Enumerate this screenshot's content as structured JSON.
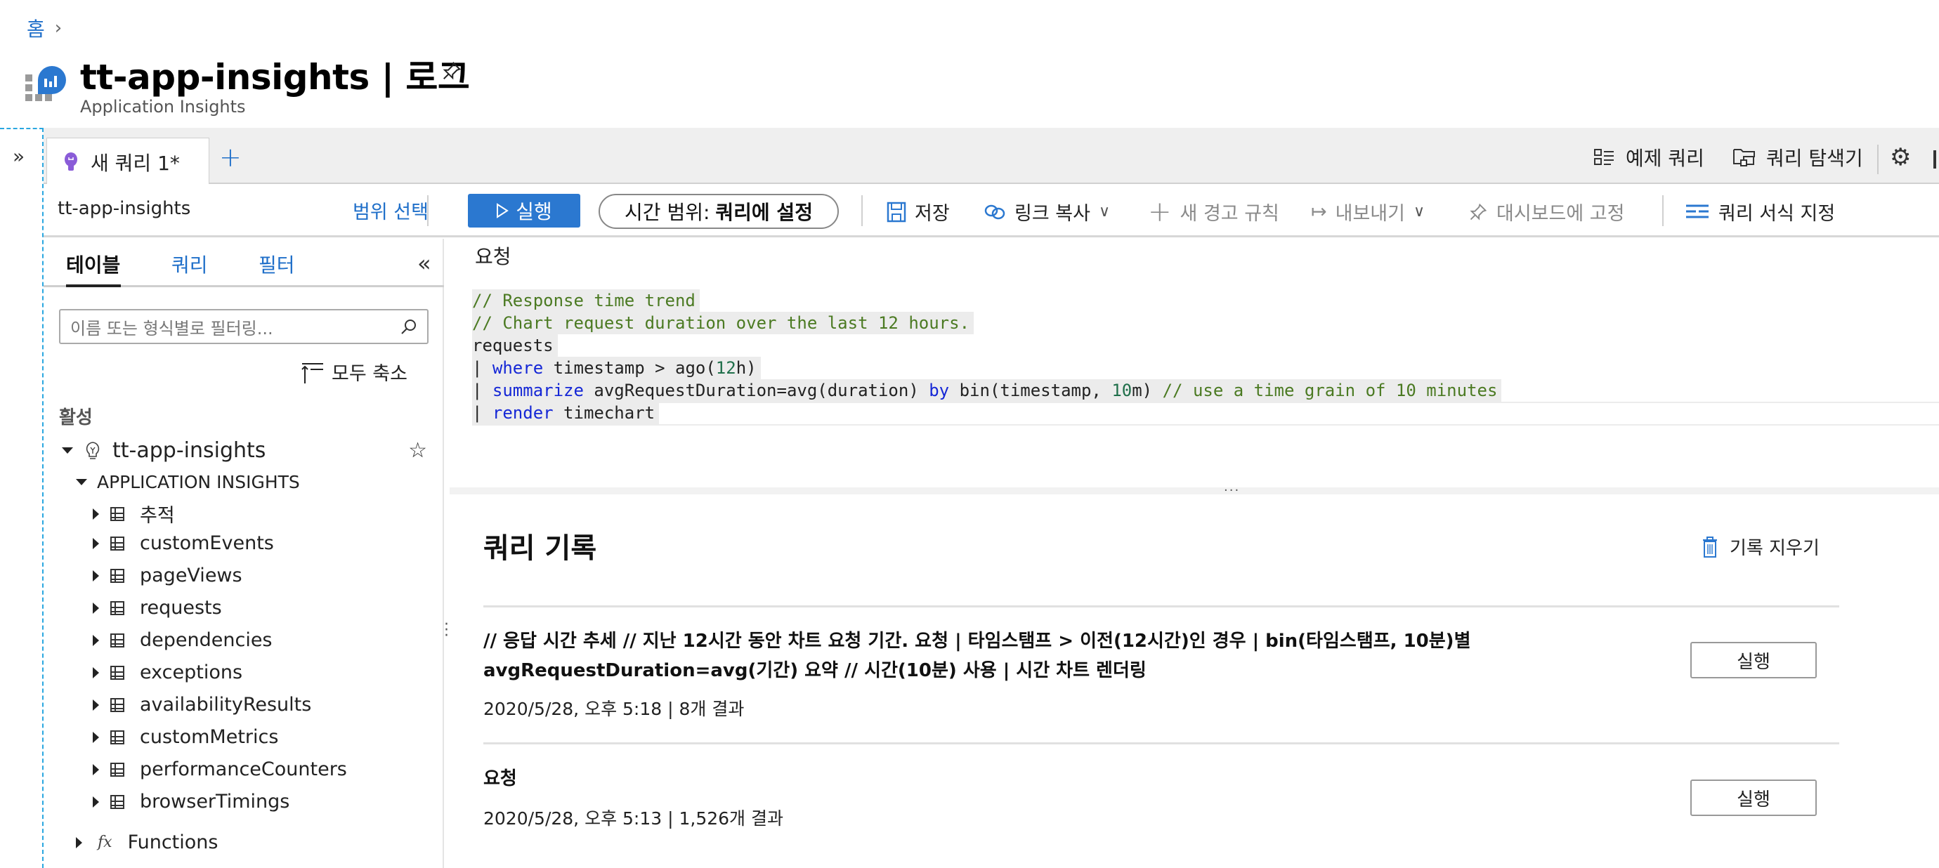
{
  "header": {
    "breadcrumb": [
      "홈"
    ],
    "title": "tt-app-insights | 로그",
    "subtitle": "Application Insights"
  },
  "tabs": {
    "items": [
      {
        "label": "새 쿼리 1*",
        "active": true,
        "icon": "lightbulb-icon"
      }
    ],
    "add_label": "+",
    "right": [
      {
        "label": "예제 쿼리",
        "icon": "sample-queries-icon"
      },
      {
        "label": "쿼리 탐색기",
        "icon": "query-explorer-icon"
      }
    ]
  },
  "toolbar": {
    "scope_name": "tt-app-insights",
    "scope_select": "범위 선택",
    "run": "실행",
    "time_range_label": "시간 범위:",
    "time_range_value": "쿼리에 설정",
    "save": "저장",
    "copy_link": "링크 복사",
    "new_alert": "새 경고 규칙",
    "export": "내보내기",
    "pin": "대시보드에 고정",
    "format": "쿼리 서식 지정"
  },
  "left_pane": {
    "tabs": [
      "테이블",
      "쿼리",
      "필터"
    ],
    "active_tab": 0,
    "filter_placeholder": "이름 또는 형식별로 필터링...",
    "collapse_all": "모두 축소",
    "section": "활성",
    "resource": "tt-app-insights",
    "group": "APPLICATION INSIGHTS",
    "tables": [
      "추적",
      "customEvents",
      "pageViews",
      "requests",
      "dependencies",
      "exceptions",
      "availabilityResults",
      "customMetrics",
      "performanceCounters",
      "browserTimings"
    ],
    "functions": "Functions"
  },
  "editor": {
    "title": "요청",
    "lines": {
      "l1": "// Response time trend",
      "l2": "// Chart request duration over the last 12 hours.",
      "l3": "requests",
      "l4_pipe": "| ",
      "l4_kw": "where",
      "l4_rest": " timestamp > ago(",
      "l4_num": "12",
      "l4_end": "h)",
      "l5_kw": "summarize",
      "l5_rest": " avgRequestDuration=avg(duration) ",
      "l5_kw2": "by",
      "l5_rest2": " bin(timestamp, ",
      "l5_num": "10",
      "l5_end": "m) ",
      "l5_cm": "// use a time grain of 10 minutes",
      "l6_kw": "render",
      "l6_rest": " timechart"
    }
  },
  "history": {
    "title": "쿼리 기록",
    "clear": "기록 지우기",
    "items": [
      {
        "query": "// 응답 시간 추세 // 지난 12시간 동안 차트 요청 기간. 요청 | 타임스탬프 > 이전(12시간)인 경우 | bin(타임스탬프, 10분)별 avgRequestDuration=avg(기간) 요약 // 시간(10분) 사용 | 시간 차트 렌더링",
        "meta": "2020/5/28, 오후 5:18 | 8개 결과",
        "run": "실행"
      },
      {
        "query": "요청",
        "meta": "2020/5/28, 오후 5:13 | 1,526개 결과",
        "run": "실행"
      }
    ]
  },
  "colors": {
    "accent": "#2b78d0",
    "link": "#1f6fc9",
    "comment": "#4b7a22",
    "keyword": "#1527d6"
  }
}
